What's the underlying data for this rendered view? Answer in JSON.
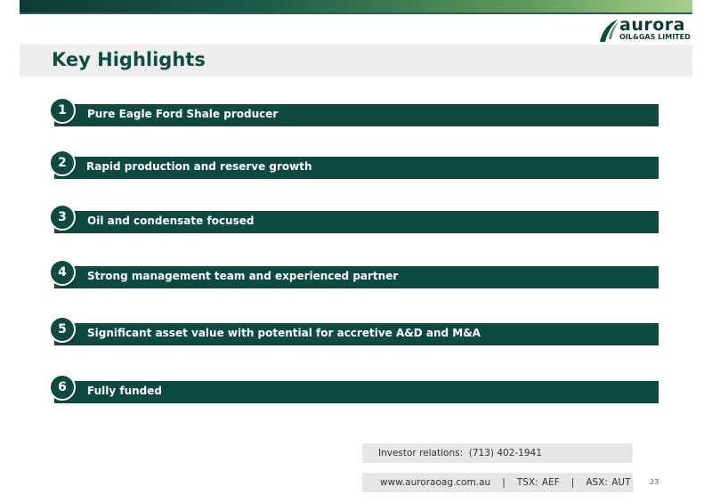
{
  "brand": {
    "name": "aurora",
    "tagline": "OIL&GAS LIMITED",
    "primary_color": "#0e4a3f",
    "accent_color": "#a9cf8a"
  },
  "page_title": "Key Highlights",
  "highlights": [
    {
      "number": "1",
      "text": "Pure Eagle Ford Shale producer"
    },
    {
      "number": "2",
      "text": "Rapid production and reserve growth"
    },
    {
      "number": "3",
      "text": "Oil and condensate focused"
    },
    {
      "number": "4",
      "text": "Strong management team and experienced partner"
    },
    {
      "number": "5",
      "text": "Significant asset value with potential for accretive A&D and M&A"
    },
    {
      "number": "6",
      "text": "Fully funded"
    }
  ],
  "footer": {
    "investor_relations": "Investor relations:  (713) 402-1941",
    "web_and_tickers": "www.auroraoag.com.au   |   TSX: AEF   |   ASX: AUT",
    "page_number": "23"
  }
}
